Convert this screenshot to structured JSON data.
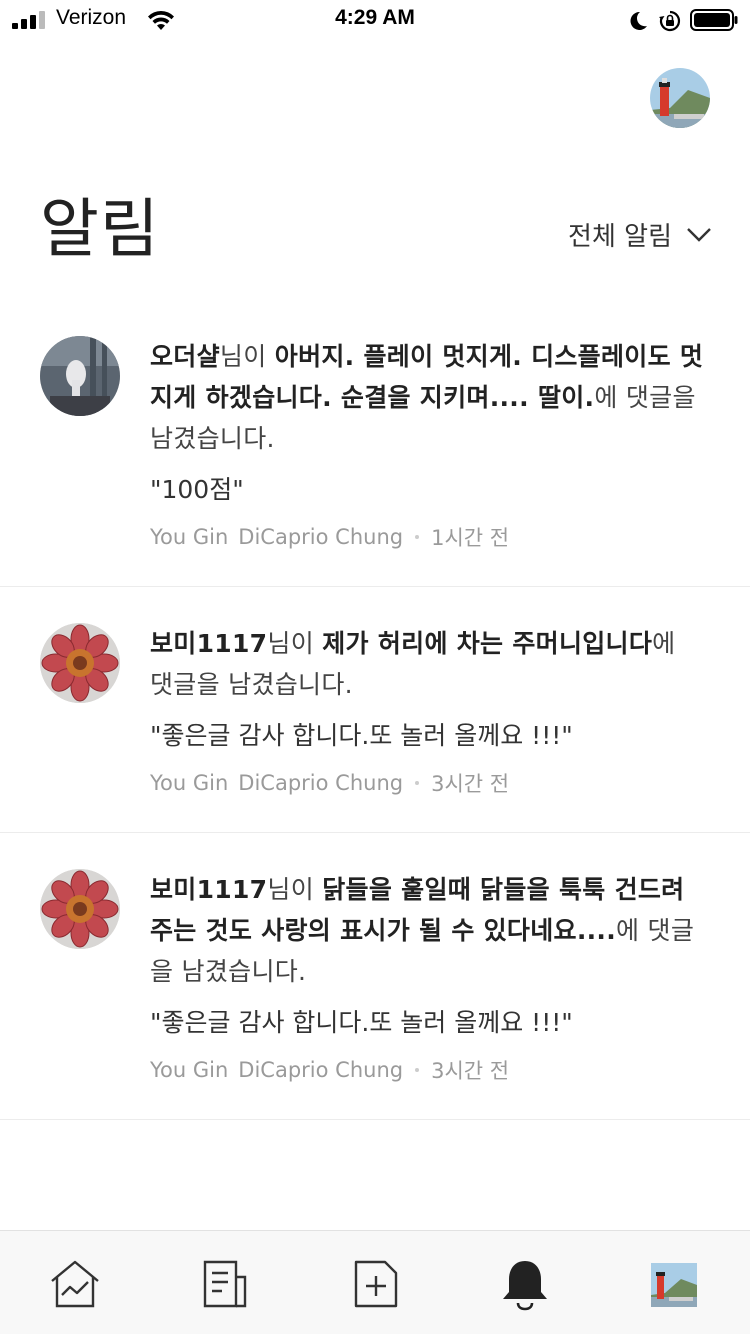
{
  "status_bar": {
    "carrier": "Verizon",
    "time": "4:29 AM"
  },
  "header": {
    "title": "알림",
    "filter_label": "전체 알림"
  },
  "notifications": [
    {
      "user": "오더샬",
      "user_suffix": "님이 ",
      "post": "아버지. 플레이 멋지게. 디스플레이도 멋지게 하겠습니다. 순결을 지키며.... 딸이.",
      "action": "에 댓글을 남겼습니다.",
      "quote": "\"100점\"",
      "meta_user1": "You Gin",
      "meta_user2": "DiCaprio Chung",
      "time": "1시간 전",
      "avatar": "hand-photo"
    },
    {
      "user": "보미1117",
      "user_suffix": "님이 ",
      "post": "제가 허리에 차는 주머니입니다",
      "action": "에 댓글을 남겼습니다.",
      "quote": "\"좋은글 감사 합니다.또 놀러 올께요 !!!\"",
      "meta_user1": "You Gin",
      "meta_user2": "DiCaprio Chung",
      "time": "3시간 전",
      "avatar": "flower-photo"
    },
    {
      "user": "보미1117",
      "user_suffix": "님이 ",
      "post": "닭들을 훝일때 닭들을 툭툭 건드려주는 것도 사랑의 표시가 될 수 있다네요....",
      "action": "에 댓글을 남겼습니다.",
      "quote": "\"좋은글 감사 합니다.또 놀러 올께요 !!!\"",
      "meta_user1": "You Gin",
      "meta_user2": "DiCaprio Chung",
      "time": "3시간 전",
      "avatar": "flower-photo"
    }
  ],
  "tabbar": {
    "tabs": [
      "home-stats-icon",
      "document-icon",
      "new-post-icon",
      "bell-icon",
      "profile-thumbnail"
    ],
    "active": "bell-icon"
  }
}
